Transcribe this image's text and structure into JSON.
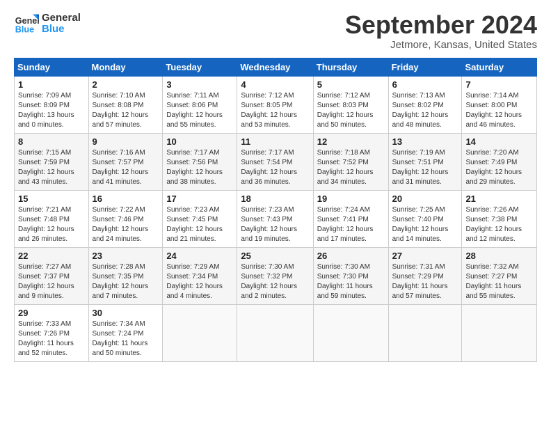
{
  "logo": {
    "line1": "General",
    "line2": "Blue"
  },
  "title": "September 2024",
  "location": "Jetmore, Kansas, United States",
  "headers": [
    "Sunday",
    "Monday",
    "Tuesday",
    "Wednesday",
    "Thursday",
    "Friday",
    "Saturday"
  ],
  "weeks": [
    [
      {
        "day": "1",
        "sunrise": "Sunrise: 7:09 AM",
        "sunset": "Sunset: 8:09 PM",
        "daylight": "Daylight: 13 hours and 0 minutes."
      },
      {
        "day": "2",
        "sunrise": "Sunrise: 7:10 AM",
        "sunset": "Sunset: 8:08 PM",
        "daylight": "Daylight: 12 hours and 57 minutes."
      },
      {
        "day": "3",
        "sunrise": "Sunrise: 7:11 AM",
        "sunset": "Sunset: 8:06 PM",
        "daylight": "Daylight: 12 hours and 55 minutes."
      },
      {
        "day": "4",
        "sunrise": "Sunrise: 7:12 AM",
        "sunset": "Sunset: 8:05 PM",
        "daylight": "Daylight: 12 hours and 53 minutes."
      },
      {
        "day": "5",
        "sunrise": "Sunrise: 7:12 AM",
        "sunset": "Sunset: 8:03 PM",
        "daylight": "Daylight: 12 hours and 50 minutes."
      },
      {
        "day": "6",
        "sunrise": "Sunrise: 7:13 AM",
        "sunset": "Sunset: 8:02 PM",
        "daylight": "Daylight: 12 hours and 48 minutes."
      },
      {
        "day": "7",
        "sunrise": "Sunrise: 7:14 AM",
        "sunset": "Sunset: 8:00 PM",
        "daylight": "Daylight: 12 hours and 46 minutes."
      }
    ],
    [
      {
        "day": "8",
        "sunrise": "Sunrise: 7:15 AM",
        "sunset": "Sunset: 7:59 PM",
        "daylight": "Daylight: 12 hours and 43 minutes."
      },
      {
        "day": "9",
        "sunrise": "Sunrise: 7:16 AM",
        "sunset": "Sunset: 7:57 PM",
        "daylight": "Daylight: 12 hours and 41 minutes."
      },
      {
        "day": "10",
        "sunrise": "Sunrise: 7:17 AM",
        "sunset": "Sunset: 7:56 PM",
        "daylight": "Daylight: 12 hours and 38 minutes."
      },
      {
        "day": "11",
        "sunrise": "Sunrise: 7:17 AM",
        "sunset": "Sunset: 7:54 PM",
        "daylight": "Daylight: 12 hours and 36 minutes."
      },
      {
        "day": "12",
        "sunrise": "Sunrise: 7:18 AM",
        "sunset": "Sunset: 7:52 PM",
        "daylight": "Daylight: 12 hours and 34 minutes."
      },
      {
        "day": "13",
        "sunrise": "Sunrise: 7:19 AM",
        "sunset": "Sunset: 7:51 PM",
        "daylight": "Daylight: 12 hours and 31 minutes."
      },
      {
        "day": "14",
        "sunrise": "Sunrise: 7:20 AM",
        "sunset": "Sunset: 7:49 PM",
        "daylight": "Daylight: 12 hours and 29 minutes."
      }
    ],
    [
      {
        "day": "15",
        "sunrise": "Sunrise: 7:21 AM",
        "sunset": "Sunset: 7:48 PM",
        "daylight": "Daylight: 12 hours and 26 minutes."
      },
      {
        "day": "16",
        "sunrise": "Sunrise: 7:22 AM",
        "sunset": "Sunset: 7:46 PM",
        "daylight": "Daylight: 12 hours and 24 minutes."
      },
      {
        "day": "17",
        "sunrise": "Sunrise: 7:23 AM",
        "sunset": "Sunset: 7:45 PM",
        "daylight": "Daylight: 12 hours and 21 minutes."
      },
      {
        "day": "18",
        "sunrise": "Sunrise: 7:23 AM",
        "sunset": "Sunset: 7:43 PM",
        "daylight": "Daylight: 12 hours and 19 minutes."
      },
      {
        "day": "19",
        "sunrise": "Sunrise: 7:24 AM",
        "sunset": "Sunset: 7:41 PM",
        "daylight": "Daylight: 12 hours and 17 minutes."
      },
      {
        "day": "20",
        "sunrise": "Sunrise: 7:25 AM",
        "sunset": "Sunset: 7:40 PM",
        "daylight": "Daylight: 12 hours and 14 minutes."
      },
      {
        "day": "21",
        "sunrise": "Sunrise: 7:26 AM",
        "sunset": "Sunset: 7:38 PM",
        "daylight": "Daylight: 12 hours and 12 minutes."
      }
    ],
    [
      {
        "day": "22",
        "sunrise": "Sunrise: 7:27 AM",
        "sunset": "Sunset: 7:37 PM",
        "daylight": "Daylight: 12 hours and 9 minutes."
      },
      {
        "day": "23",
        "sunrise": "Sunrise: 7:28 AM",
        "sunset": "Sunset: 7:35 PM",
        "daylight": "Daylight: 12 hours and 7 minutes."
      },
      {
        "day": "24",
        "sunrise": "Sunrise: 7:29 AM",
        "sunset": "Sunset: 7:34 PM",
        "daylight": "Daylight: 12 hours and 4 minutes."
      },
      {
        "day": "25",
        "sunrise": "Sunrise: 7:30 AM",
        "sunset": "Sunset: 7:32 PM",
        "daylight": "Daylight: 12 hours and 2 minutes."
      },
      {
        "day": "26",
        "sunrise": "Sunrise: 7:30 AM",
        "sunset": "Sunset: 7:30 PM",
        "daylight": "Daylight: 11 hours and 59 minutes."
      },
      {
        "day": "27",
        "sunrise": "Sunrise: 7:31 AM",
        "sunset": "Sunset: 7:29 PM",
        "daylight": "Daylight: 11 hours and 57 minutes."
      },
      {
        "day": "28",
        "sunrise": "Sunrise: 7:32 AM",
        "sunset": "Sunset: 7:27 PM",
        "daylight": "Daylight: 11 hours and 55 minutes."
      }
    ],
    [
      {
        "day": "29",
        "sunrise": "Sunrise: 7:33 AM",
        "sunset": "Sunset: 7:26 PM",
        "daylight": "Daylight: 11 hours and 52 minutes."
      },
      {
        "day": "30",
        "sunrise": "Sunrise: 7:34 AM",
        "sunset": "Sunset: 7:24 PM",
        "daylight": "Daylight: 11 hours and 50 minutes."
      },
      null,
      null,
      null,
      null,
      null
    ]
  ]
}
